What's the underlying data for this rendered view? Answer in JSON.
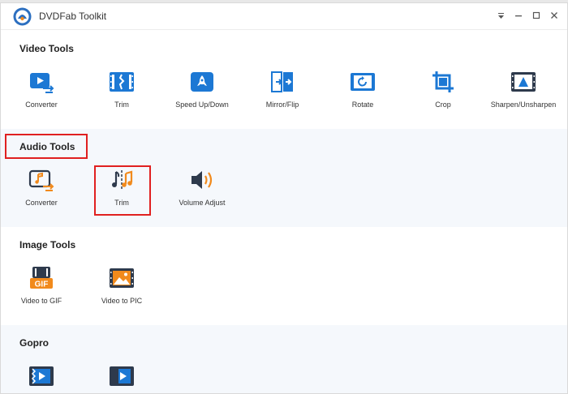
{
  "app": {
    "title": "DVDFab Toolkit"
  },
  "colors": {
    "blue": "#1c78d4",
    "orange": "#f18a1c",
    "dark": "#2e3a4c",
    "highlight": "#e02020"
  },
  "sections": [
    {
      "title": "Video Tools",
      "tools": [
        {
          "label": "Converter",
          "icon": "video-converter-icon"
        },
        {
          "label": "Trim",
          "icon": "film-trim-icon"
        },
        {
          "label": "Speed Up/Down",
          "icon": "rocket-icon"
        },
        {
          "label": "Mirror/Flip",
          "icon": "mirror-flip-icon"
        },
        {
          "label": "Rotate",
          "icon": "rotate-icon"
        },
        {
          "label": "Crop",
          "icon": "crop-icon"
        },
        {
          "label": "Sharpen/Unsharpen",
          "icon": "sharpen-icon"
        }
      ]
    },
    {
      "title": "Audio Tools",
      "tools": [
        {
          "label": "Converter",
          "icon": "audio-converter-icon"
        },
        {
          "label": "Trim",
          "icon": "audio-trim-icon"
        },
        {
          "label": "Volume Adjust",
          "icon": "speaker-icon"
        }
      ]
    },
    {
      "title": "Image Tools",
      "tools": [
        {
          "label": "Video to GIF",
          "icon": "video-to-gif-icon"
        },
        {
          "label": "Video to PIC",
          "icon": "video-to-pic-icon"
        }
      ]
    },
    {
      "title": "Gopro",
      "tools": [
        {
          "label": "",
          "icon": "gopro-film-icon"
        },
        {
          "label": "",
          "icon": "gopro-film-icon"
        }
      ]
    }
  ]
}
